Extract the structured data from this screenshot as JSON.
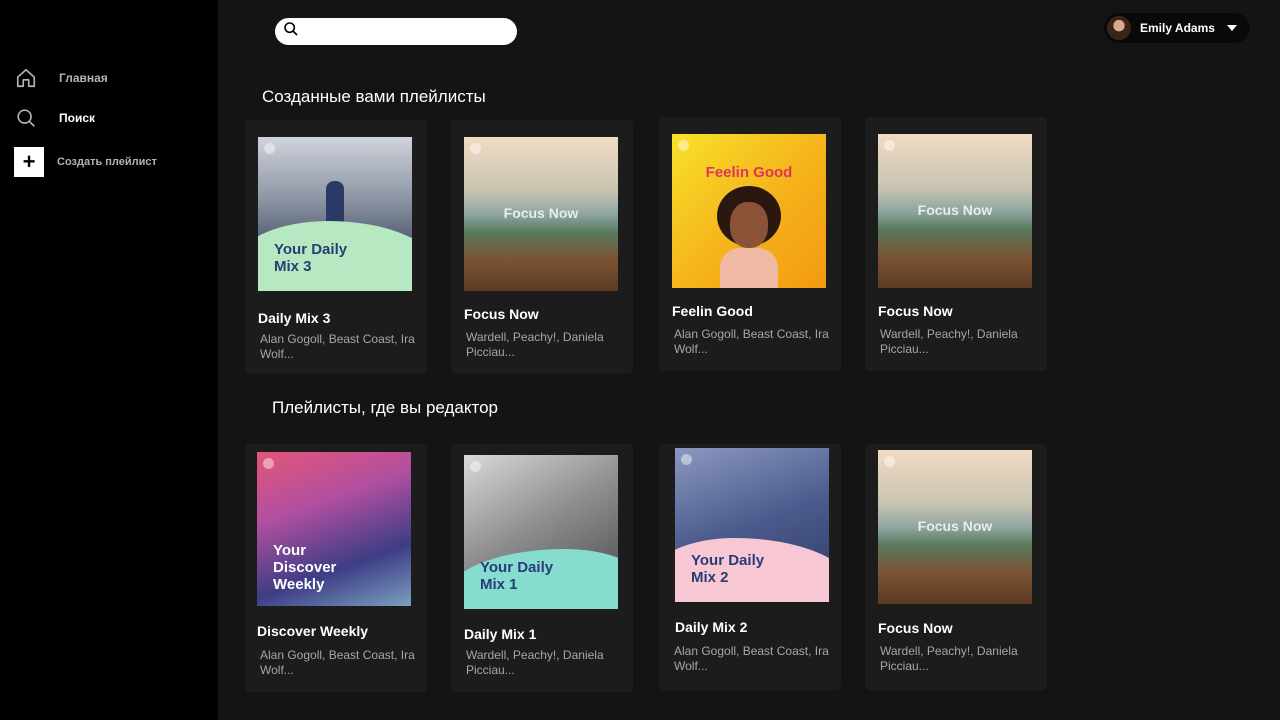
{
  "colors": {
    "background": "#121212",
    "sidebar": "#000000",
    "card": "#1c1c1c",
    "text": "#ffffff",
    "subtext": "#a7a7a7"
  },
  "sidebar": {
    "items": [
      {
        "icon": "home-icon",
        "label": "Главная"
      },
      {
        "icon": "search-icon",
        "label": "Поиск"
      },
      {
        "icon": "plus-icon",
        "label": "Создать плейлист"
      }
    ]
  },
  "search": {
    "placeholder": ""
  },
  "user": {
    "name": "Emily Adams"
  },
  "sections": [
    {
      "title": "Созданные вами плейлисты",
      "cards": [
        {
          "title": "Daily Mix 3",
          "subtitle": "Alan Gogoll, Beast Coast, Ira Wolf...",
          "cover_text": "Your Daily Mix 3"
        },
        {
          "title": "Focus Now",
          "subtitle": "Wardell, Peachy!, Daniela Picciau...",
          "cover_text": "Focus Now"
        },
        {
          "title": "Feelin Good",
          "subtitle": "Alan Gogoll, Beast Coast, Ira Wolf...",
          "cover_text": "Feelin Good"
        },
        {
          "title": "Focus Now",
          "subtitle": "Wardell, Peachy!, Daniela Picciau...",
          "cover_text": "Focus Now"
        }
      ]
    },
    {
      "title": "Плейлисты, где вы редактор",
      "cards": [
        {
          "title": "Discover Weekly",
          "subtitle": "Alan Gogoll, Beast Coast, Ira Wolf...",
          "cover_text": "Your Discover Weekly"
        },
        {
          "title": "Daily Mix 1",
          "subtitle": "Wardell, Peachy!, Daniela Picciau...",
          "cover_text": "Your Daily Mix 1"
        },
        {
          "title": "Daily Mix 2",
          "subtitle": "Alan Gogoll, Beast Coast, Ira Wolf...",
          "cover_text": "Your Daily Mix 2"
        },
        {
          "title": "Focus Now",
          "subtitle": "Wardell, Peachy!, Daniela Picciau...",
          "cover_text": "Focus Now"
        }
      ]
    }
  ]
}
